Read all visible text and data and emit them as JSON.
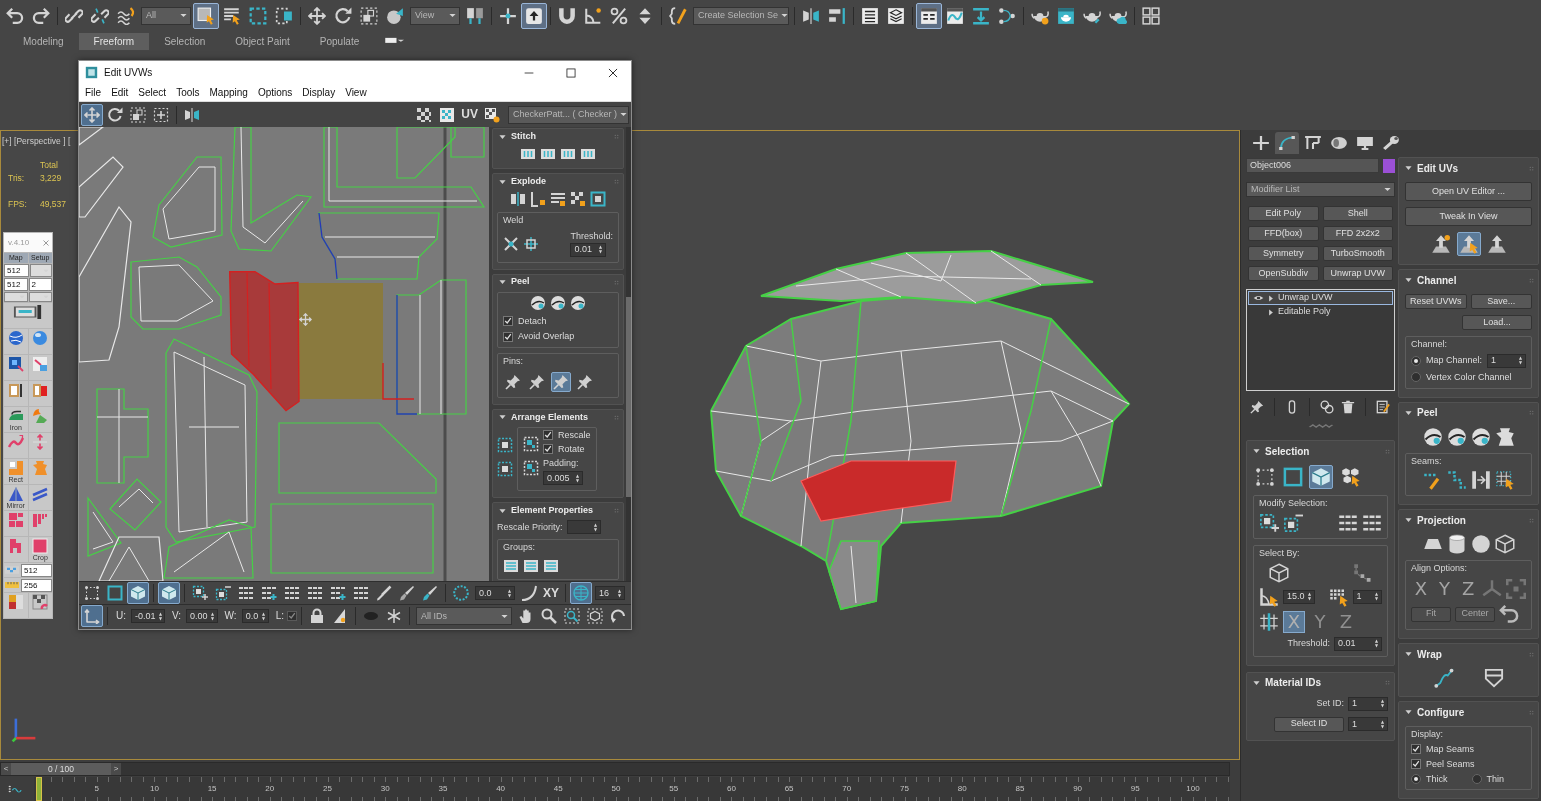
{
  "main_toolbar": {
    "tools": [
      {
        "selected": false
      },
      {
        "selected": false
      },
      {
        "selected": false
      },
      {
        "selected": false
      },
      {
        "selected": false
      },
      {
        "selected": true
      },
      {
        "selected": false
      },
      {
        "selected": false
      },
      {
        "selected": false
      },
      {
        "selected": false
      },
      {
        "selected": false
      },
      {
        "selected": false
      },
      {
        "selected": false
      },
      {
        "selected": false
      },
      {
        "selected": false
      },
      {
        "selected": true
      },
      {
        "selected": false
      },
      {
        "selected": false
      },
      {
        "selected": false
      },
      {
        "selected": false
      },
      {
        "selected": false
      },
      {
        "selected": false
      },
      {
        "selected": false
      },
      {
        "selected": false
      },
      {
        "selected": false
      },
      {
        "selected": true
      },
      {
        "selected": false
      },
      {
        "selected": false
      },
      {
        "selected": false
      },
      {
        "selected": false
      },
      {
        "selected": false
      },
      {
        "selected": false
      },
      {
        "selected": false
      },
      {
        "selected": false
      }
    ],
    "selection_filter": "All",
    "reference_coordinate": "View",
    "named_selection": "Create Selection Se"
  },
  "ribbon_tabs": [
    {
      "label": "Modeling",
      "selected": false
    },
    {
      "label": "Freeform",
      "selected": true
    },
    {
      "label": "Selection",
      "selected": false
    },
    {
      "label": "Object Paint",
      "selected": false
    },
    {
      "label": "Populate",
      "selected": false
    }
  ],
  "viewport": {
    "label": "[+] [Perspective ] [",
    "stats_header": "Total",
    "stats": [
      {
        "label": "Tris:",
        "value": "3,229"
      },
      {
        "label": "FPS:",
        "value": "49,537"
      }
    ]
  },
  "script_panel": {
    "version": "v.4.10",
    "buttons": [
      "Map",
      "Setup"
    ],
    "size_fields": [
      "512",
      "512",
      "2"
    ],
    "tool_labels": [
      "Iron",
      "Rect",
      "Mirror",
      "Crop"
    ],
    "texel_fields": [
      "512",
      "256"
    ]
  },
  "uv_editor": {
    "title": "Edit UVWs",
    "menu": [
      "File",
      "Edit",
      "Select",
      "Tools",
      "Mapping",
      "Options",
      "Display",
      "View"
    ],
    "tools": [
      {
        "selected": true
      },
      {
        "selected": false
      },
      {
        "selected": false
      },
      {
        "selected": false
      },
      {
        "selected": false
      }
    ],
    "view_label": "UV",
    "texture": "CheckerPatt... ( Checker )",
    "rollouts": [
      {
        "kind": "stitch",
        "title": "Stitch",
        "expanded": true
      },
      {
        "kind": "explode",
        "title": "Explode",
        "expanded": true,
        "group": "Weld",
        "spinner": {
          "label": "Threshold:",
          "value": "0.01"
        }
      },
      {
        "kind": "peel",
        "title": "Peel",
        "expanded": true,
        "checks": [
          {
            "label": "Detach",
            "checked": true
          },
          {
            "label": "Avoid Overlap",
            "checked": true
          }
        ],
        "group": "Pins:",
        "pins": [
          {
            "selected": false
          },
          {
            "selected": false
          },
          {
            "selected": true
          },
          {
            "selected": false
          }
        ]
      },
      {
        "kind": "arrange",
        "title": "Arrange Elements",
        "expanded": true,
        "checks": [
          {
            "label": "Rescale",
            "checked": true
          },
          {
            "label": "Rotate",
            "checked": true
          }
        ],
        "spinner": {
          "label": "Padding:",
          "value": "0.005"
        }
      },
      {
        "kind": "properties",
        "title": "Element Properties",
        "expanded": true,
        "spinner": {
          "label": "Rescale Priority:"
        },
        "group": "Groups:"
      }
    ],
    "bottom_bar": {
      "tools": [
        {
          "selected": false
        },
        {
          "selected": false
        },
        {
          "selected": true
        },
        {
          "selected": true
        },
        {
          "selected": false
        },
        {
          "selected": false
        },
        {
          "selected": false
        },
        {
          "selected": false
        },
        {
          "selected": false
        },
        {
          "selected": false
        },
        {
          "selected": false
        },
        {
          "selected": false
        },
        {
          "selected": false
        },
        {
          "selected": false
        },
        {
          "selected": false
        },
        {
          "selected": false
        },
        {
          "selected": false
        },
        {
          "selected": true
        }
      ],
      "falloff": "0.0",
      "space": "XY",
      "size": "16"
    },
    "coordinate_bar": {
      "tools": [
        {
          "selected": true
        },
        {
          "selected": false
        },
        {
          "selected": false
        },
        {
          "selected": false
        },
        {
          "selected": false
        },
        {
          "selected": false
        },
        {
          "selected": false
        },
        {
          "selected": false
        },
        {
          "selected": false
        },
        {
          "selected": false
        }
      ],
      "coords": [
        {
          "label": "U:",
          "value": "-0.01"
        },
        {
          "label": "V:",
          "value": "0.00"
        },
        {
          "label": "W:",
          "value": "0.0"
        }
      ],
      "lock": {
        "label": "L:",
        "checked": true
      },
      "filter": "All IDs"
    }
  },
  "timeline": {
    "prev": "<",
    "position": "0 / 100",
    "next": ">",
    "level": 0,
    "ticks": [
      "5",
      "10",
      "15",
      "20",
      "25",
      "30",
      "35",
      "40",
      "45",
      "50",
      "55",
      "60",
      "65",
      "70",
      "75",
      "80",
      "85",
      "90",
      "95",
      "100"
    ]
  },
  "command_panel": {
    "tabs": [
      {
        "selected": false
      },
      {
        "selected": true
      },
      {
        "selected": false
      },
      {
        "selected": false
      },
      {
        "selected": false
      },
      {
        "selected": false
      }
    ],
    "object": {
      "name": "Object006",
      "color": "#9b50d6"
    },
    "modifier_list": "Modifier List",
    "modifier_buttons": [
      "Edit Poly",
      "Shell",
      "FFD(box)",
      "FFD 2x2x2",
      "Symmetry",
      "TurboSmooth",
      "OpenSubdiv",
      "Unwrap UVW"
    ],
    "stack": [
      {
        "kind": "modifier",
        "label": "Unwrap UVW",
        "selected": true,
        "expanded": false
      },
      {
        "kind": "base",
        "label": "Editable Poly",
        "selected": false,
        "expanded": false
      }
    ],
    "rollouts_left": [
      {
        "kind": "selection",
        "title": "Selection",
        "expanded": true,
        "modes": [
          {
            "selected": false
          },
          {
            "selected": false
          },
          {
            "selected": true
          }
        ],
        "modify_label": "Modify Selection:",
        "select_by_label": "Select By:",
        "angle": "15.0",
        "step": "1",
        "axes": [
          {
            "label": "X",
            "selected": true
          },
          {
            "label": "Y",
            "selected": false
          },
          {
            "label": "Z",
            "selected": false
          }
        ],
        "spinner": {
          "label": "Threshold:",
          "value": "0.01"
        }
      },
      {
        "kind": "material",
        "title": "Material IDs",
        "expanded": true,
        "set_id": {
          "label": "Set ID:",
          "value": "1"
        },
        "select_id": {
          "label": "Select ID",
          "value": "1"
        }
      }
    ],
    "rollouts_right": [
      {
        "kind": "edit_uvs",
        "title": "Edit UVs",
        "expanded": true,
        "buttons": [
          "Open UV Editor ...",
          "Tweak In View"
        ],
        "tools": [
          {
            "selected": false
          },
          {
            "selected": true
          },
          {
            "selected": false
          }
        ]
      },
      {
        "kind": "channel",
        "title": "Channel",
        "expanded": true,
        "buttons": [
          "Reset UVWs",
          "Save...",
          "Load..."
        ],
        "group": "Channel:",
        "radios": [
          {
            "label": "Map Channel:",
            "selected": true,
            "value": "1"
          },
          {
            "label": "Vertex Color Channel",
            "selected": false
          }
        ]
      },
      {
        "kind": "peel",
        "title": "Peel",
        "expanded": true,
        "group": "Seams:"
      },
      {
        "kind": "projection",
        "title": "Projection",
        "expanded": true,
        "group": "Align Options:",
        "axes": [
          {
            "label": "X",
            "disabled": true
          },
          {
            "label": "Y",
            "disabled": true
          },
          {
            "label": "Z",
            "disabled": true
          }
        ],
        "buttons": [
          {
            "label": "Fit",
            "disabled": true
          },
          {
            "label": "Center",
            "disabled": true
          }
        ]
      },
      {
        "kind": "wrap",
        "title": "Wrap",
        "expanded": true
      },
      {
        "kind": "configure",
        "title": "Configure",
        "expanded": true,
        "group": "Display:",
        "checks": [
          {
            "label": "Map Seams",
            "checked": true
          },
          {
            "label": "Peel Seams",
            "checked": true
          }
        ],
        "radios": [
          {
            "label": "Thick",
            "selected": true
          },
          {
            "label": "Thin",
            "selected": false
          }
        ]
      }
    ]
  }
}
